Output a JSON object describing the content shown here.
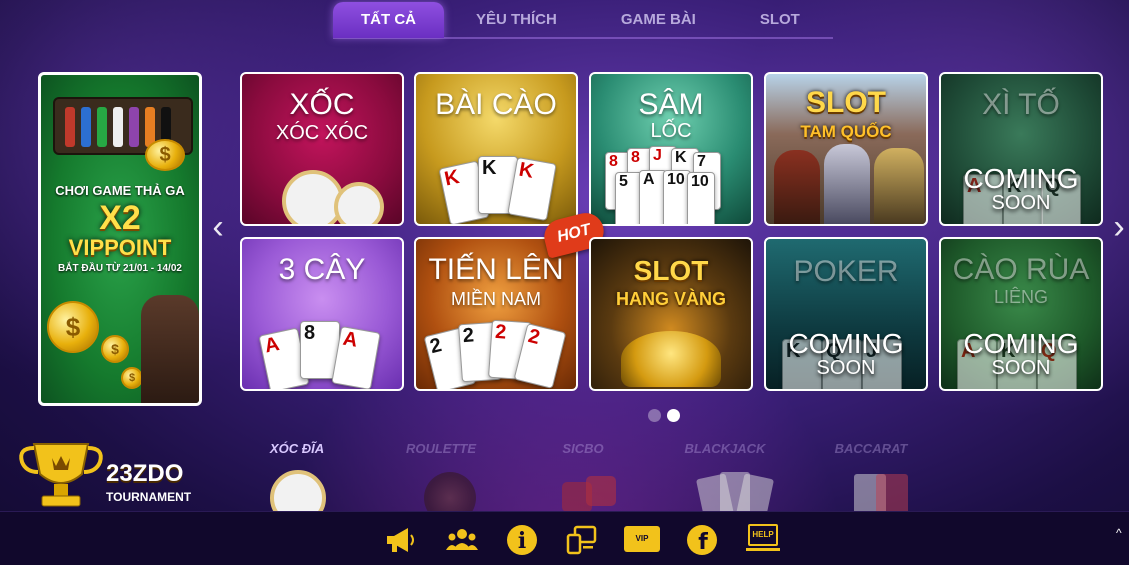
{
  "tabs": [
    {
      "label": "TẤT CẢ",
      "active": true
    },
    {
      "label": "YÊU THÍCH",
      "active": false
    },
    {
      "label": "GAME BÀI",
      "active": false
    },
    {
      "label": "SLOT",
      "active": false
    }
  ],
  "promo": {
    "line1": "CHƠI GAME THẢ GA",
    "line2": "X2",
    "line3": "VIPPOINT",
    "line4": "BẮT ĐẦU TỪ 21/01 - 14/02"
  },
  "games": [
    {
      "title": "XỐC",
      "subtitle": "XÓC XÓC"
    },
    {
      "title": "BÀI CÀO",
      "subtitle": ""
    },
    {
      "title": "SÂM",
      "subtitle": "LỐC"
    },
    {
      "title": "SLOT",
      "subtitle": "TAM QUỐC"
    },
    {
      "title": "XÌ TỐ",
      "subtitle": "",
      "coming": "COMING",
      "soon": "SOON"
    },
    {
      "title": "3 CÂY",
      "subtitle": ""
    },
    {
      "title": "TIẾN LÊN",
      "subtitle": "MIỀN NAM",
      "badge": "HOT"
    },
    {
      "title": "SLOT",
      "subtitle": "HANG VÀNG"
    },
    {
      "title": "POKER",
      "subtitle": "",
      "coming": "COMING",
      "soon": "SOON"
    },
    {
      "title": "CÀO RÙA",
      "subtitle": "LIÊNG",
      "coming": "COMING",
      "soon": "SOON"
    }
  ],
  "tournament": {
    "name": "23ZDO",
    "sub": "TOURNAMENT"
  },
  "mini_games": [
    {
      "label": "XÓC ĐĨA",
      "active": true
    },
    {
      "label": "ROULETTE",
      "active": false
    },
    {
      "label": "SICBO",
      "active": false
    },
    {
      "label": "BLACKJACK",
      "active": false
    },
    {
      "label": "BACCARAT",
      "active": false
    }
  ],
  "bottom_icons": [
    {
      "name": "megaphone-icon"
    },
    {
      "name": "users-icon"
    },
    {
      "name": "info-icon",
      "glyph": "i"
    },
    {
      "name": "devices-icon"
    },
    {
      "name": "vip-pass-icon",
      "text": "VIP PASS"
    },
    {
      "name": "facebook-icon",
      "glyph": "f"
    },
    {
      "name": "help-icon",
      "text": "HELP"
    }
  ],
  "colors": {
    "accent": "#8f4fe0",
    "gold": "#ffd84a",
    "bar": "#11082c",
    "icon": "#f2c21b"
  }
}
